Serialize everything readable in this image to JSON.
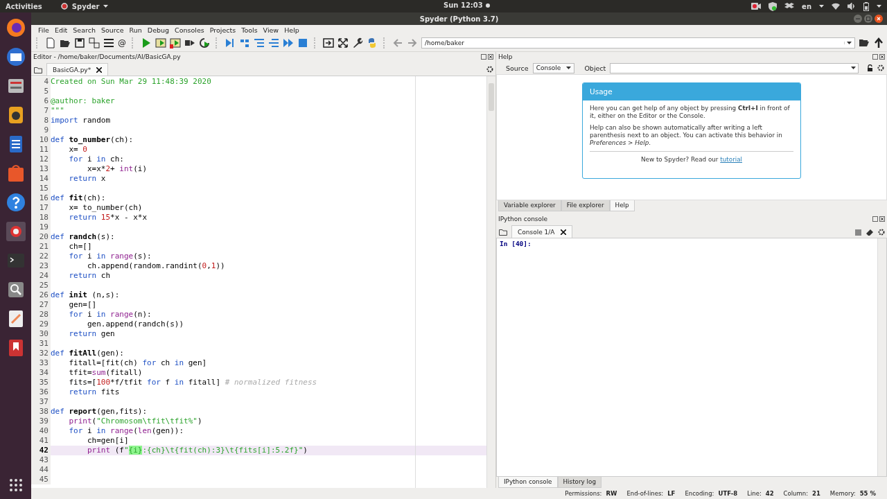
{
  "top_bar": {
    "activities": "Activities",
    "app_menu": "Spyder",
    "clock": "Sun 12:03",
    "keyboard": "en"
  },
  "window": {
    "title": "Spyder (Python 3.7)"
  },
  "menu": [
    "File",
    "Edit",
    "Search",
    "Source",
    "Run",
    "Debug",
    "Consoles",
    "Projects",
    "Tools",
    "View",
    "Help"
  ],
  "toolbar": {
    "at_symbol": "@",
    "path": "/home/baker"
  },
  "editor": {
    "title": "Editor - /home/baker/Documents/AI/BasicGA.py",
    "tabs": [
      {
        "label": "BasicGA.py*",
        "selected": true
      }
    ],
    "lines": [
      {
        "number": "4",
        "current": false,
        "tokens": [
          {
            "kind": "str",
            "text": "Created on Sun Mar 29 11:48:39 2020"
          }
        ]
      },
      {
        "number": "5",
        "current": false
      },
      {
        "number": "6",
        "current": false,
        "tokens": [
          {
            "kind": "str",
            "text": "@author: baker"
          }
        ]
      },
      {
        "number": "7",
        "current": false,
        "tokens": [
          {
            "kind": "str",
            "text": "\"\"\""
          }
        ]
      },
      {
        "number": "8",
        "current": false,
        "tokens": [
          {
            "kind": "kw",
            "text": "import"
          },
          {
            "kind": "plain",
            "text": " random"
          }
        ]
      },
      {
        "number": "9",
        "current": false
      },
      {
        "number": "10",
        "current": false,
        "tokens": [
          {
            "kind": "kw",
            "text": "def"
          },
          {
            "kind": "fn",
            "text": " to_number"
          },
          {
            "kind": "plain",
            "text": "(ch):"
          }
        ]
      },
      {
        "number": "11",
        "current": false,
        "tokens": [
          {
            "kind": "plain",
            "text": "    x= "
          },
          {
            "kind": "num",
            "text": "0"
          }
        ]
      },
      {
        "number": "12",
        "current": false,
        "tokens": [
          {
            "kind": "kw",
            "text": "    for"
          },
          {
            "kind": "plain",
            "text": " i "
          },
          {
            "kind": "kw",
            "text": "in"
          },
          {
            "kind": "plain",
            "text": " ch:"
          }
        ]
      },
      {
        "number": "13",
        "current": false,
        "tokens": [
          {
            "kind": "plain",
            "text": "        x=x*"
          },
          {
            "kind": "num",
            "text": "2"
          },
          {
            "kind": "plain",
            "text": "+ "
          },
          {
            "kind": "builtin",
            "text": "int"
          },
          {
            "kind": "plain",
            "text": "(i)"
          }
        ]
      },
      {
        "number": "14",
        "current": false,
        "tokens": [
          {
            "kind": "kw",
            "text": "    return"
          },
          {
            "kind": "plain",
            "text": " x"
          }
        ]
      },
      {
        "number": "15",
        "current": false
      },
      {
        "number": "16",
        "current": false,
        "tokens": [
          {
            "kind": "kw",
            "text": "def"
          },
          {
            "kind": "fn",
            "text": " fit"
          },
          {
            "kind": "plain",
            "text": "(ch):"
          }
        ]
      },
      {
        "number": "17",
        "current": false,
        "tokens": [
          {
            "kind": "plain",
            "text": "    x= to_number(ch)"
          }
        ]
      },
      {
        "number": "18",
        "current": false,
        "tokens": [
          {
            "kind": "kw",
            "text": "    return"
          },
          {
            "kind": "num",
            "text": " 15"
          },
          {
            "kind": "plain",
            "text": "*x - x*x"
          }
        ]
      },
      {
        "number": "19",
        "current": false
      },
      {
        "number": "20",
        "current": false,
        "tokens": [
          {
            "kind": "kw",
            "text": "def"
          },
          {
            "kind": "fn",
            "text": " randch"
          },
          {
            "kind": "plain",
            "text": "(s):"
          }
        ]
      },
      {
        "number": "21",
        "current": false,
        "tokens": [
          {
            "kind": "plain",
            "text": "    ch=[]"
          }
        ]
      },
      {
        "number": "22",
        "current": false,
        "tokens": [
          {
            "kind": "kw",
            "text": "    for"
          },
          {
            "kind": "plain",
            "text": " i "
          },
          {
            "kind": "kw",
            "text": "in"
          },
          {
            "kind": "builtin",
            "text": " range"
          },
          {
            "kind": "plain",
            "text": "(s):"
          }
        ]
      },
      {
        "number": "23",
        "current": false,
        "tokens": [
          {
            "kind": "plain",
            "text": "        ch.append(random.randint("
          },
          {
            "kind": "num",
            "text": "0"
          },
          {
            "kind": "plain",
            "text": ","
          },
          {
            "kind": "num",
            "text": "1"
          },
          {
            "kind": "plain",
            "text": "))"
          }
        ]
      },
      {
        "number": "24",
        "current": false,
        "tokens": [
          {
            "kind": "kw",
            "text": "    return"
          },
          {
            "kind": "plain",
            "text": " ch"
          }
        ]
      },
      {
        "number": "25",
        "current": false
      },
      {
        "number": "26",
        "current": false,
        "tokens": [
          {
            "kind": "kw",
            "text": "def"
          },
          {
            "kind": "fn",
            "text": " init"
          },
          {
            "kind": "plain",
            "text": " (n,s):"
          }
        ]
      },
      {
        "number": "27",
        "current": false,
        "tokens": [
          {
            "kind": "plain",
            "text": "    gen=[]"
          }
        ]
      },
      {
        "number": "28",
        "current": false,
        "tokens": [
          {
            "kind": "kw",
            "text": "    for"
          },
          {
            "kind": "plain",
            "text": " i "
          },
          {
            "kind": "kw",
            "text": "in"
          },
          {
            "kind": "builtin",
            "text": " range"
          },
          {
            "kind": "plain",
            "text": "(n):"
          }
        ]
      },
      {
        "number": "29",
        "current": false,
        "tokens": [
          {
            "kind": "plain",
            "text": "        gen.append(randch(s))"
          }
        ]
      },
      {
        "number": "30",
        "current": false,
        "tokens": [
          {
            "kind": "kw",
            "text": "    return"
          },
          {
            "kind": "plain",
            "text": " gen"
          }
        ]
      },
      {
        "number": "31",
        "current": false
      },
      {
        "number": "32",
        "current": false,
        "tokens": [
          {
            "kind": "kw",
            "text": "def"
          },
          {
            "kind": "fn",
            "text": " fitAll"
          },
          {
            "kind": "plain",
            "text": "(gen):"
          }
        ]
      },
      {
        "number": "33",
        "current": false,
        "tokens": [
          {
            "kind": "plain",
            "text": "    fitall=[fit(ch) "
          },
          {
            "kind": "kw",
            "text": "for"
          },
          {
            "kind": "plain",
            "text": " ch "
          },
          {
            "kind": "kw",
            "text": "in"
          },
          {
            "kind": "plain",
            "text": " gen]"
          }
        ]
      },
      {
        "number": "34",
        "current": false,
        "tokens": [
          {
            "kind": "plain",
            "text": "    tfit="
          },
          {
            "kind": "builtin",
            "text": "sum"
          },
          {
            "kind": "plain",
            "text": "(fitall)"
          }
        ]
      },
      {
        "number": "35",
        "current": false,
        "tokens": [
          {
            "kind": "plain",
            "text": "    fits=["
          },
          {
            "kind": "num",
            "text": "100"
          },
          {
            "kind": "plain",
            "text": "*f/tfit "
          },
          {
            "kind": "kw",
            "text": "for"
          },
          {
            "kind": "plain",
            "text": " f "
          },
          {
            "kind": "kw",
            "text": "in"
          },
          {
            "kind": "plain",
            "text": " fitall]"
          },
          {
            "kind": "comment",
            "text": " # normalized fitness"
          }
        ]
      },
      {
        "number": "36",
        "current": false,
        "tokens": [
          {
            "kind": "kw",
            "text": "    return"
          },
          {
            "kind": "plain",
            "text": " fits"
          }
        ]
      },
      {
        "number": "37",
        "current": false
      },
      {
        "number": "38",
        "current": false,
        "tokens": [
          {
            "kind": "kw",
            "text": "def"
          },
          {
            "kind": "fn",
            "text": " report"
          },
          {
            "kind": "plain",
            "text": "(gen,fits):"
          }
        ]
      },
      {
        "number": "39",
        "current": false,
        "tokens": [
          {
            "kind": "builtin",
            "text": "    print"
          },
          {
            "kind": "plain",
            "text": "("
          },
          {
            "kind": "str",
            "text": "\"Chromosom\\tfit\\tfit%\""
          },
          {
            "kind": "plain",
            "text": ")"
          }
        ]
      },
      {
        "number": "40",
        "current": false,
        "tokens": [
          {
            "kind": "kw",
            "text": "    for"
          },
          {
            "kind": "plain",
            "text": " i "
          },
          {
            "kind": "kw",
            "text": "in"
          },
          {
            "kind": "builtin",
            "text": " range"
          },
          {
            "kind": "plain",
            "text": "("
          },
          {
            "kind": "builtin",
            "text": "len"
          },
          {
            "kind": "plain",
            "text": "(gen)):"
          }
        ]
      },
      {
        "number": "41",
        "current": false,
        "tokens": [
          {
            "kind": "plain",
            "text": "        ch=gen[i]"
          }
        ]
      },
      {
        "number": "42",
        "current": true,
        "tokens": [
          {
            "kind": "builtin",
            "text": "        print"
          },
          {
            "kind": "plain",
            "text": " (f"
          },
          {
            "kind": "str",
            "text": "\""
          },
          {
            "kind": "match",
            "text": "{i}"
          },
          {
            "kind": "str",
            "text": ":{ch}\\t{fit(ch):3}\\t{fits[i]:5.2f}\""
          },
          {
            "kind": "plain",
            "text": ")"
          }
        ]
      },
      {
        "number": "43",
        "current": false
      },
      {
        "number": "44",
        "current": false
      },
      {
        "number": "45",
        "current": false
      }
    ]
  },
  "help": {
    "title": "Help",
    "source_label": "Source",
    "source_value": "Console",
    "object_label": "Object",
    "card_title": "Usage",
    "paragraphs": [
      "Here you can get help of any object by pressing **Ctrl+I** in front of it, either on the Editor or the Console.",
      "Help can also be shown automatically after writing a left parenthesis next to an object. You can activate this behavior in *Preferences > Help*."
    ],
    "footer": "New to Spyder? Read our ",
    "footer_link": "tutorial",
    "tabs": [
      {
        "label": "Variable explorer",
        "selected": false
      },
      {
        "label": "File explorer",
        "selected": false
      },
      {
        "label": "Help",
        "selected": true
      }
    ]
  },
  "console": {
    "title": "IPython console",
    "tabs": [
      {
        "label": "Console 1/A",
        "selected": true
      }
    ],
    "prompt": "In [40]:",
    "bottom_tabs": [
      {
        "label": "IPython console",
        "selected": true
      },
      {
        "label": "History log",
        "selected": false
      }
    ]
  },
  "status_bar": [
    {
      "label": "Permissions:",
      "value": "RW"
    },
    {
      "label": "End-of-lines:",
      "value": "LF"
    },
    {
      "label": "Encoding:",
      "value": "UTF-8"
    },
    {
      "label": "Line:",
      "value": "42"
    },
    {
      "label": "Column:",
      "value": "21"
    },
    {
      "label": "Memory:",
      "value": "55 %"
    }
  ]
}
